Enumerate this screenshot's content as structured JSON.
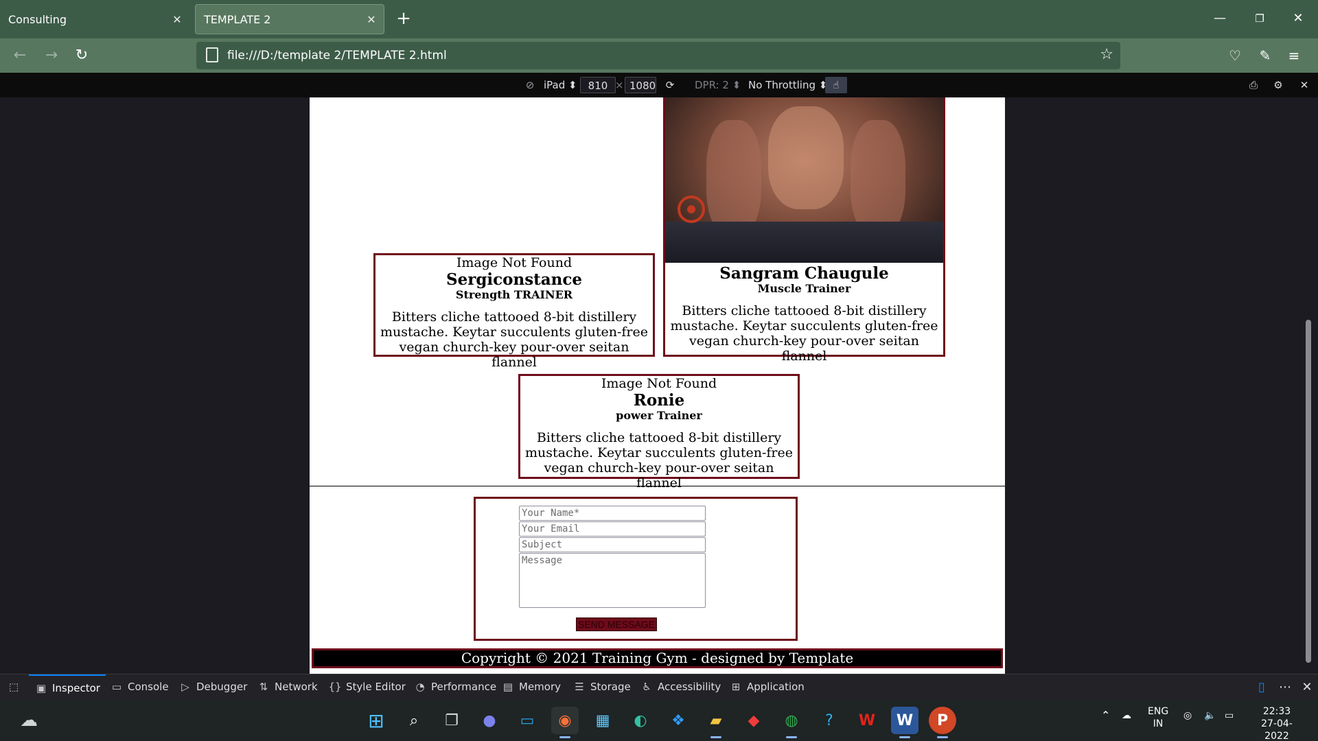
{
  "browser": {
    "tabs": [
      {
        "title": "Consulting",
        "active": false
      },
      {
        "title": "TEMPLATE 2",
        "active": true
      }
    ],
    "url": "file:///D:/template 2/TEMPLATE 2.html"
  },
  "rdm": {
    "device": "iPad",
    "width": "810",
    "times": "×",
    "height": "1080",
    "dpr": "DPR: 2",
    "throttling": "No Throttling"
  },
  "page": {
    "trainers": [
      {
        "image_text": "Image Not Found",
        "name": "Sergiconstance",
        "role": "Strength TRAINER",
        "desc": "Bitters cliche tattooed 8-bit distillery mustache. Keytar succulents gluten-free vegan church-key pour-over seitan flannel"
      },
      {
        "image_text": "",
        "name": "Sangram Chaugule",
        "role": "Muscle Trainer",
        "desc": "Bitters cliche tattooed 8-bit distillery mustache. Keytar succulents gluten-free vegan church-key pour-over seitan flannel"
      },
      {
        "image_text": "Image Not Found",
        "name": "Ronie",
        "role": "power Trainer",
        "desc": "Bitters cliche tattooed 8-bit distillery mustache. Keytar succulents gluten-free vegan church-key pour-over seitan flannel"
      }
    ],
    "form": {
      "name_placeholder": "Your Name*",
      "email_placeholder": "Your Email",
      "subject_placeholder": "Subject",
      "message_placeholder": "Message",
      "send_label": "SEND MESSAGE"
    },
    "footer": "Copyright © 2021 Training Gym - designed by Template"
  },
  "devtools": {
    "tabs": [
      "Inspector",
      "Console",
      "Debugger",
      "Network",
      "Style Editor",
      "Performance",
      "Memory",
      "Storage",
      "Accessibility",
      "Application"
    ],
    "active": "Inspector"
  },
  "taskbar": {
    "lang": "ENG",
    "region": "IN",
    "time": "22:33",
    "date": "27-04-2022"
  },
  "colors": {
    "accent_maroon": "#6e0b1a",
    "browser_green": "#3d5c48"
  }
}
